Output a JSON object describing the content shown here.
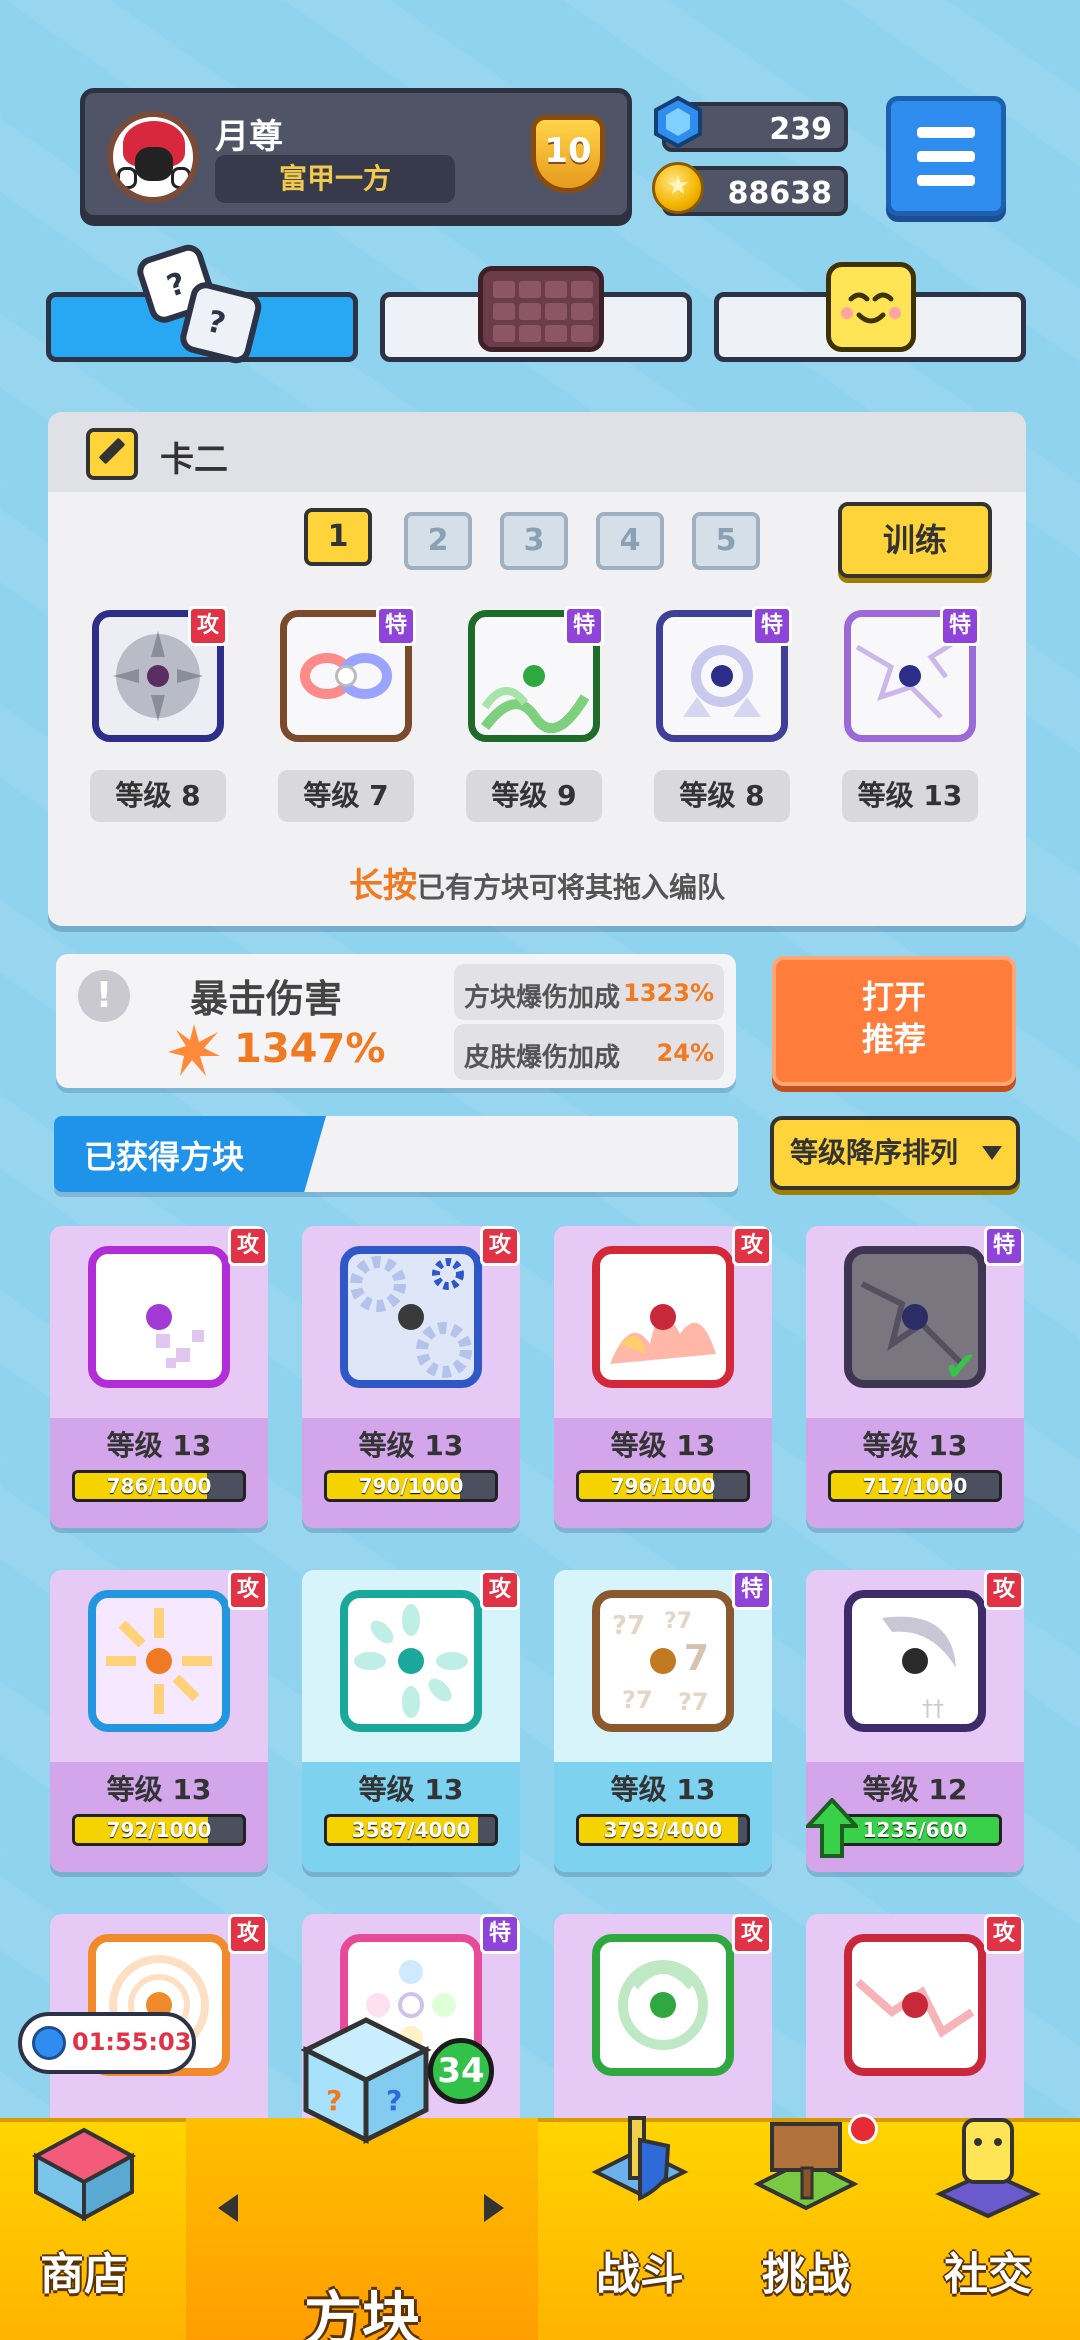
{
  "profile": {
    "name": "月尊",
    "title": "富甲一方",
    "rank": "10"
  },
  "resources": {
    "gems": "239",
    "coins": "88638",
    "coin_glyph": "★"
  },
  "tabs": [
    {
      "icon": "dice-icon",
      "active": true
    },
    {
      "icon": "grid-icon",
      "active": false
    },
    {
      "icon": "smile-face-icon",
      "active": false
    }
  ],
  "deck": {
    "name": "卡二",
    "numbers": [
      "1",
      "2",
      "3",
      "4",
      "5"
    ],
    "train_label": "训练",
    "slots": [
      {
        "tag": "攻",
        "level": "等级 8"
      },
      {
        "tag": "特",
        "level": "等级 7"
      },
      {
        "tag": "特",
        "level": "等级 9"
      },
      {
        "tag": "特",
        "level": "等级 8"
      },
      {
        "tag": "特",
        "level": "等级 13"
      }
    ],
    "hint_highlight": "长按",
    "hint_text": "已有方块可将其拖入编队"
  },
  "crit": {
    "bang": "!",
    "title": "暴击伤害",
    "value": "1347%",
    "block_label": "方块爆伤加成",
    "block_value": "1323%",
    "skin_label": "皮肤爆伤加成",
    "skin_value": "24%"
  },
  "recommend": {
    "line1": "打开",
    "line2": "推荐"
  },
  "obtained": {
    "label": "已获得方块",
    "sort_label": "等级降序排列"
  },
  "cards": [
    {
      "tag": "攻",
      "level": "等级 13",
      "progress": "786/1000",
      "fill": 0.786
    },
    {
      "tag": "攻",
      "level": "等级 13",
      "progress": "790/1000",
      "fill": 0.79
    },
    {
      "tag": "攻",
      "level": "等级 13",
      "progress": "796/1000",
      "fill": 0.796
    },
    {
      "tag": "特",
      "level": "等级 13",
      "progress": "717/1000",
      "fill": 0.717,
      "check": "✔"
    },
    {
      "tag": "攻",
      "level": "等级 13",
      "progress": "792/1000",
      "fill": 0.792
    },
    {
      "tag": "攻",
      "level": "等级 13",
      "progress": "3587/4000",
      "fill": 0.897
    },
    {
      "tag": "特",
      "level": "等级 13",
      "progress": "3793/4000",
      "fill": 0.948
    },
    {
      "tag": "攻",
      "level": "等级 12",
      "progress": "1235/600",
      "fill": 1.0
    },
    {
      "tag": "攻"
    },
    {
      "tag": "特"
    },
    {
      "tag": "攻"
    },
    {
      "tag": "攻"
    }
  ],
  "timer": "01:55:03",
  "nav": {
    "shop": "商店",
    "blocks": "方块",
    "blocks_badge": "34",
    "battle": "战斗",
    "challenge": "挑战",
    "social": "社交"
  },
  "colors": {
    "attack_tag": "#e23346",
    "special_tag": "#8e44d8",
    "accent_orange": "#f07a22",
    "accent_yellow": "#ffd43b",
    "primary_blue": "#28a8f2"
  }
}
